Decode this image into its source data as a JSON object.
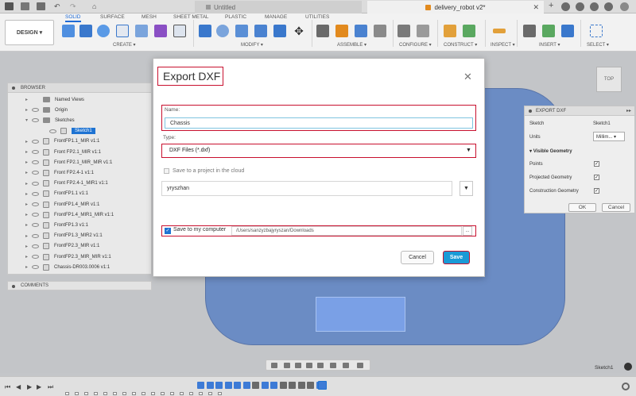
{
  "app": {
    "tabs": [
      {
        "label": "Untitled"
      },
      {
        "label": "delivery_robot v2*"
      }
    ]
  },
  "ribbon": {
    "workspace": "DESIGN ▾",
    "tabs": [
      "SOLID",
      "SURFACE",
      "MESH",
      "SHEET METAL",
      "PLASTIC",
      "MANAGE",
      "UTILITIES"
    ],
    "groups": [
      "CREATE ▾",
      "MODIFY ▾",
      "ASSEMBLE ▾",
      "CONFIGURE ▾",
      "CONSTRUCT ▾",
      "INSPECT ▾",
      "INSERT ▾",
      "SELECT ▾"
    ]
  },
  "browser": {
    "title": "BROWSER",
    "items": [
      {
        "label": "Named Views"
      },
      {
        "label": "Origin"
      },
      {
        "label": "Sketches"
      },
      {
        "label": "Sketch1"
      },
      {
        "label": "FrontFP1.1_MIR v1:1"
      },
      {
        "label": "Front FP2.1_MIR v1:1"
      },
      {
        "label": "Front FP2.1_MIR_MIR v1:1"
      },
      {
        "label": "Front FP2.4-1 v1:1"
      },
      {
        "label": "Front FP2.4-1_MIR1 v1:1"
      },
      {
        "label": "FrontFP1.1 v1:1"
      },
      {
        "label": "FrontFP1.4_MIR v1:1"
      },
      {
        "label": "FrontFP1.4_MIR1_MIR v1:1"
      },
      {
        "label": "FrontFP1.3 v1:1"
      },
      {
        "label": "FrontFP1.3_MIR2 v1:1"
      },
      {
        "label": "FrontFP2.3_MIR v1:1"
      },
      {
        "label": "FrontFP2.3_MIR_MIR v1:1"
      },
      {
        "label": "Chassis-DR003.0006 v1:1"
      }
    ],
    "comments": "COMMENTS"
  },
  "viewcube": {
    "label": "TOP"
  },
  "export_panel": {
    "title": "EXPORT DXF",
    "sketch_label": "Sketch",
    "sketch_value": "Sketch1",
    "units_label": "Units",
    "units_value": "Millim... ▾",
    "visible_geometry": "Visible Geometry",
    "points_label": "Points",
    "projected_label": "Projected Geometry",
    "construction_label": "Construction Geometry",
    "ok": "OK",
    "cancel": "Cancel"
  },
  "dialog": {
    "title": "Export DXF",
    "name_label": "Name:",
    "name_value": "Chassis",
    "type_label": "Type:",
    "type_value": "DXF Files (*.dxf)",
    "cloud_label": "Save to a project in the cloud",
    "project_value": "yryszhan",
    "save_computer_label": "Save to my computer",
    "path_value": "/Users/sanzyzbajyryszan/Downloads",
    "path_btn": "...",
    "cancel": "Cancel",
    "save": "Save"
  },
  "statusbar": {
    "active_sketch": "Sketch1"
  },
  "colors": {
    "accent": "#1e73d2",
    "highlight": "#c8102e",
    "save_button": "#1b9ad6",
    "body": "#6b8cc4"
  }
}
